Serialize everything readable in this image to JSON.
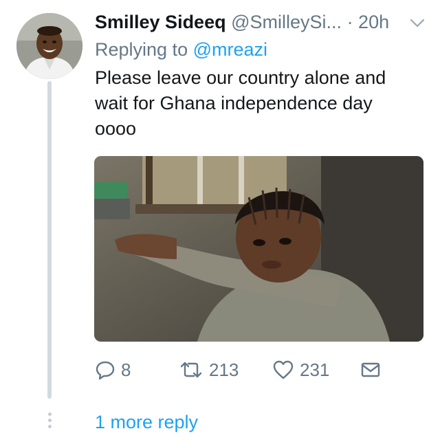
{
  "tweet": {
    "display_name": "Smilley Sideeq",
    "handle": "@SmilleySi...",
    "time": "· 20h",
    "replying_prefix": "Replying to",
    "replying_to": "@mreazi",
    "text_lines": [
      "Please leave our country alone and",
      "wait for Ghana independence day",
      "oooo"
    ],
    "actions": {
      "replies": "8",
      "retweets": "213",
      "likes": "231"
    }
  },
  "thread": {
    "more_replies_label": "1 more reply"
  },
  "icons": {
    "menu": "chevron-down-icon",
    "reply": "reply-icon",
    "retweet": "retweet-icon",
    "like": "heart-icon",
    "dm": "envelope-icon"
  },
  "colors": {
    "link_blue": "#1da1f2",
    "secondary_gray": "#657786",
    "text_dark": "#14171a",
    "thread_line": "#d3dadf"
  }
}
